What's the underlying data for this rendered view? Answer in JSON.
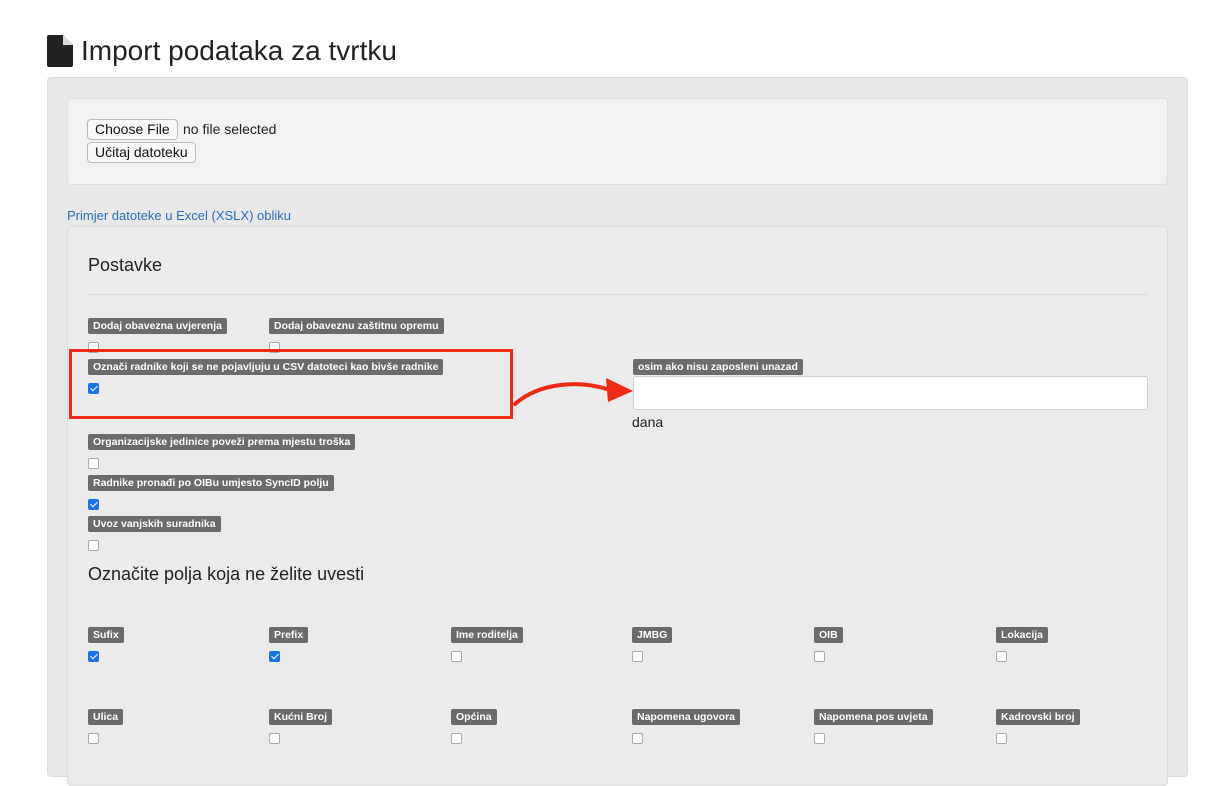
{
  "page": {
    "title": "Import podataka za tvrtku"
  },
  "upload": {
    "choose_file_label": "Choose File",
    "no_file_text": "no file selected",
    "load_button_label": "Učitaj datoteku"
  },
  "sample_link": "Primjer datoteke u Excel (XSLX) obliku",
  "settings": {
    "title": "Postavke",
    "options": [
      {
        "label": "Dodaj obavezna uvjerenja",
        "checked": false
      },
      {
        "label": "Dodaj obaveznu zaštitnu opremu",
        "checked": false
      },
      {
        "label": "Označi radnike koji se ne pojavljuju u CSV datoteci kao bivše radnike",
        "checked": true
      },
      {
        "label": "Organizacijske jedinice poveži prema mjestu troška",
        "checked": false
      },
      {
        "label": "Radnike pronađi po OIBu umjesto SyncID polju",
        "checked": true
      },
      {
        "label": "Uvoz vanjskih suradnika",
        "checked": false
      }
    ],
    "unless_label": "osim ako nisu zaposleni unazad",
    "unless_value": "",
    "unless_unit": "dana"
  },
  "fields": {
    "title": "Označite polja koja ne želite uvesti",
    "items": [
      {
        "label": "Sufix",
        "checked": true
      },
      {
        "label": "Prefix",
        "checked": true
      },
      {
        "label": "Ime roditelja",
        "checked": false
      },
      {
        "label": "JMBG",
        "checked": false
      },
      {
        "label": "OIB",
        "checked": false
      },
      {
        "label": "Lokacija",
        "checked": false
      },
      {
        "label": "Ulica",
        "checked": false
      },
      {
        "label": "Kućni Broj",
        "checked": false
      },
      {
        "label": "Općina",
        "checked": false
      },
      {
        "label": "Napomena ugovora",
        "checked": false
      },
      {
        "label": "Napomena pos uvjeta",
        "checked": false
      },
      {
        "label": "Kadrovski broj",
        "checked": false
      }
    ]
  },
  "colors": {
    "highlight": "#ee2a14",
    "checkbox_checked": "#1a73e8",
    "label_bg": "#6b6b6b",
    "link": "#2a6ebb"
  },
  "icons": {
    "title_icon": "file-icon"
  }
}
